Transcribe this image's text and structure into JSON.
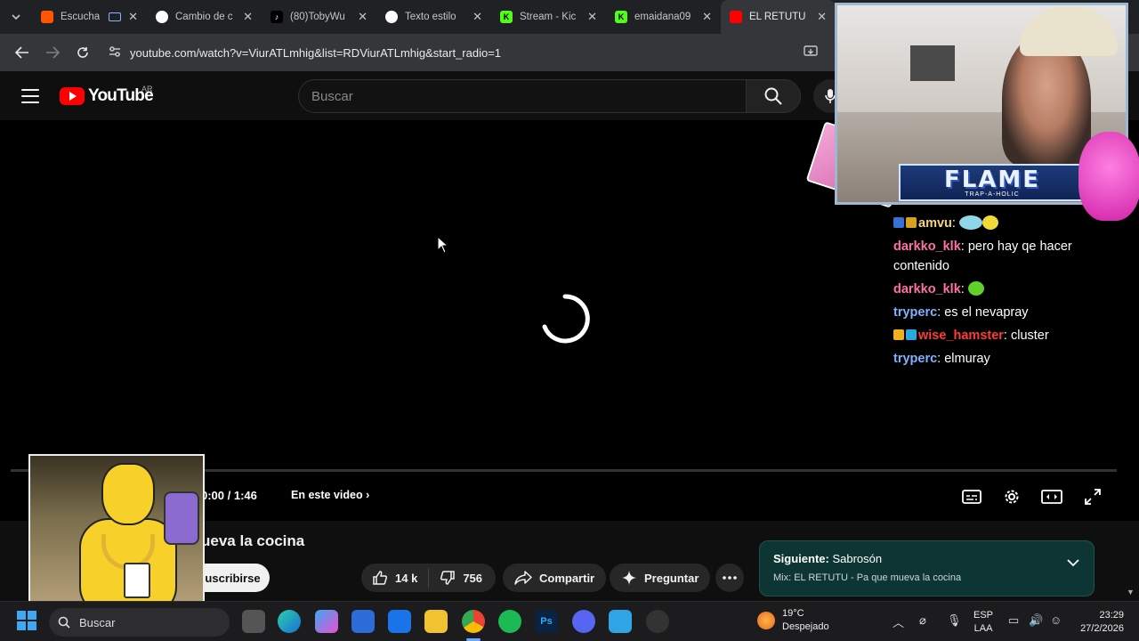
{
  "browser": {
    "tabs": [
      {
        "title": "Escucha",
        "favicon_color": "#ff5500",
        "active": false
      },
      {
        "title": "Cambio de c",
        "favicon_color": "#ffffff",
        "active": false
      },
      {
        "title": "(80)TobyWu",
        "favicon_color": "#000000",
        "active": false
      },
      {
        "title": "Texto estilo",
        "favicon_color": "#ffffff",
        "active": false
      },
      {
        "title": "Stream - Kic",
        "favicon_color": "#53fc18",
        "active": false
      },
      {
        "title": "emaidana09",
        "favicon_color": "#53fc18",
        "active": false
      },
      {
        "title": "EL RETUTU",
        "favicon_color": "#ff0000",
        "active": true
      }
    ],
    "url": "youtube.com/watch?v=ViurATLmhig&list=RDViurATLmhig&start_radio=1"
  },
  "youtube": {
    "logo_text": "YouTube",
    "region": "AR",
    "search_placeholder": "Buscar"
  },
  "player": {
    "state": "loading",
    "time": "0:00 / 1:46",
    "chapters_label": "En este video"
  },
  "video": {
    "title_visible": "ueva la cocina",
    "subscribe_label": "uscribirse",
    "likes": "14 k",
    "dislikes": "756",
    "share_label": "Compartir",
    "ask_label": "Preguntar"
  },
  "up_next": {
    "label": "Siguiente:",
    "title": "Sabrosón",
    "mix": "Mix: EL RETUTU - Pa que mueva la cocina"
  },
  "overlay": {
    "flame_text": "FLAME",
    "flame_sub": "TRAP-A-HOLIC",
    "chat": [
      {
        "user": "amvu",
        "text": "",
        "color": "#f5d76e"
      },
      {
        "user": "darkko_klk",
        "text": "pero hay qe hacer contenido",
        "color": "#ff6fa8"
      },
      {
        "user": "darkko_klk",
        "text": "",
        "color": "#ff6fa8"
      },
      {
        "user": "tryperc",
        "text": "es el nevapray",
        "color": "#7fb2ff"
      },
      {
        "user": "wise_hamster",
        "text": "cluster",
        "color": "#ff3b3b"
      },
      {
        "user": "tryperc",
        "text": "elmuray",
        "color": "#7fb2ff"
      }
    ]
  },
  "taskbar": {
    "search_label": "Buscar",
    "weather_temp": "19°C",
    "weather_desc": "Despejado",
    "weather_alert": "1",
    "lang_line1": "ESP",
    "lang_line2": "LAA",
    "time": "23:29",
    "date": "27/2/2026"
  }
}
